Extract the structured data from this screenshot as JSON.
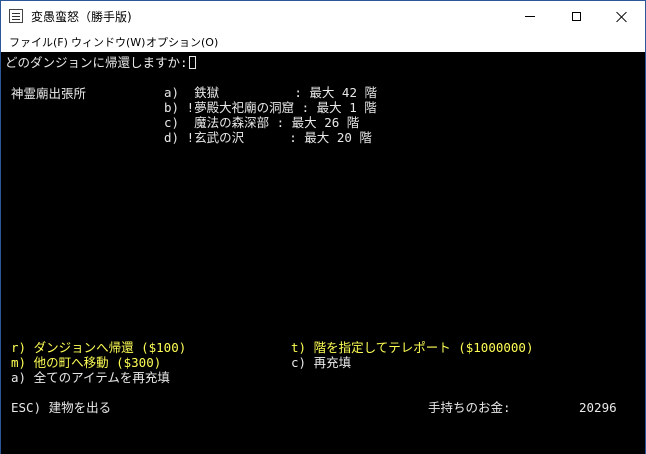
{
  "window": {
    "title": "変愚蛮怒（勝手版)",
    "menu": [
      "ファイル(F)",
      "ウィンドウ(W)",
      "オプション(O)"
    ]
  },
  "terminal": {
    "prompt": "どのダンジョンに帰還しますか:",
    "location": "神霊廟出張所",
    "dungeons": [
      "a)  鉄獄          : 最大 42 階",
      "b) !夢殿大祀廟の洞窟 : 最大 1 階",
      "c)  魔法の森深部 : 最大 26 階",
      "d) !玄武の沢      : 最大 20 階"
    ],
    "commands": {
      "recall": "r) ダンジョンへ帰還 ($100)",
      "teleport_level": "t) 階を指定してテレポート ($1000000)",
      "move_town": "m) 他の町へ移動 ($300)",
      "recharge": "c) 再充填",
      "recharge_all": "a) 全てのアイテムを再充填",
      "exit": "ESC) 建物を出る"
    },
    "gold_label": "手持ちのお金:",
    "gold_value": "20296"
  },
  "colors": {
    "terminal_bg": "#000000",
    "text_white": "#e8e8e8",
    "text_yellow": "#ffff55",
    "window_border": "#2b579a"
  }
}
